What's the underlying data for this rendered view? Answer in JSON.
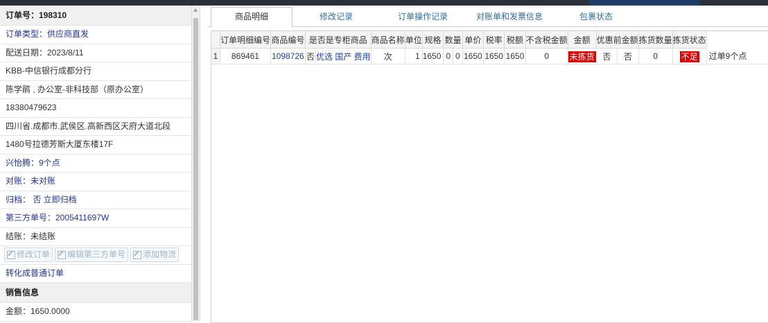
{
  "left": {
    "order_no": "订单号：198310",
    "order_type": "订单类型：供应商直发",
    "delivery_date": "配送日期：2023/8/11",
    "customer": "KBB-中信银行成都分行",
    "contact": "陈学鹃 , 办公室-非科技部（原办公室）",
    "phone": "18380479623",
    "address1": "四川省.成都市.武侯区.高新西区天府大道北段",
    "address2": "1480号拉德芳斯大厦东楼17F",
    "picker": "兴怡腾：9个点",
    "reconcile": "对账：未对账",
    "archive": "归档：  否 立即归档",
    "third_party": "第三方单号：2005411697W",
    "settle": "结账：未结账",
    "buttons": [
      "修改订单",
      "编辑第三方单号",
      "添加物流"
    ],
    "convert": "转化成普通订单",
    "sales_header": "销售信息",
    "amount": "金额：1650.0000"
  },
  "tabs": [
    "商品明细",
    "修改记录",
    "订单操作记录",
    "对账单和发票信息",
    "包裹状态"
  ],
  "table": {
    "headers": [
      "订单明细编号",
      "商品编号",
      "是否是专柜商品",
      "商品名称",
      "单位",
      "规格",
      "数量",
      "单价",
      "税率",
      "税额",
      "不含税金额",
      "金额",
      "优惠前金额",
      "拣货数量",
      "拣货状态"
    ],
    "row": {
      "index": "1",
      "detail_no": "869461",
      "product_no": "1098726",
      "is_counter": "否",
      "name": "优选 国产 费用",
      "unit": "次",
      "spec": "1",
      "qty": "1650",
      "price": "0",
      "tax_rate": "0",
      "tax": "1650",
      "net_amount": "1650",
      "amount": "1650",
      "pre_discount": "0",
      "pick_qty": "未拣货",
      "pick_status_a": "否",
      "pick_status_b": "否",
      "pick_status_c": "0",
      "shortage": "不足",
      "note": "过单9个点"
    }
  }
}
